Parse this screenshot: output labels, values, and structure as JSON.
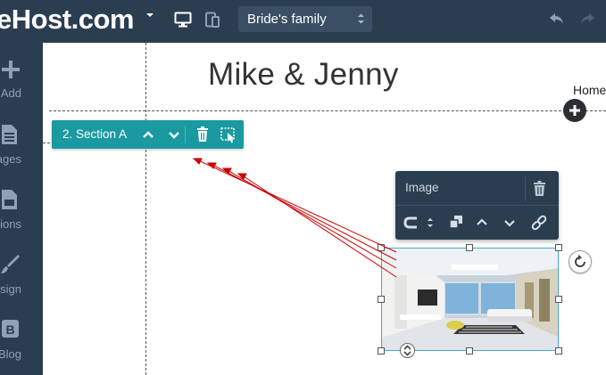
{
  "topbar": {
    "logo_text": "eHost.com",
    "page_select_value": "Bride's family"
  },
  "sidebar": {
    "items": [
      {
        "label": "Add",
        "icon": "plus-icon"
      },
      {
        "label": "Pages",
        "icon": "page-icon"
      },
      {
        "label": "Sections",
        "icon": "sections-icon"
      },
      {
        "label": "Design",
        "icon": "brush-icon"
      },
      {
        "label": "Blog",
        "icon": "blog-icon"
      }
    ]
  },
  "canvas": {
    "site_title": "Mike & Jenny",
    "nav_home": "Home"
  },
  "section_toolbar": {
    "label": "2. Section A"
  },
  "image_toolbar": {
    "title": "Image"
  },
  "colors": {
    "chrome": "#2b3e50",
    "section_accent": "#1a9aa0",
    "annotation_arrows": "#cc0000",
    "selection": "#48a8d0"
  }
}
